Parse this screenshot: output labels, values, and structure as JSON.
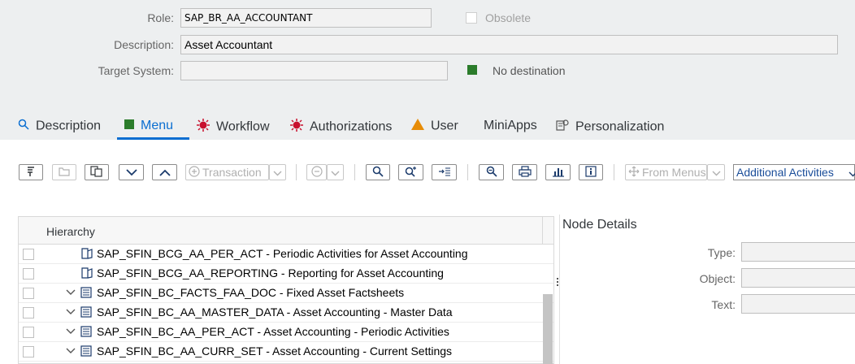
{
  "header": {
    "role_label": "Role:",
    "role_value": "SAP_BR_AA_ACCOUNTANT",
    "obsolete_label": "Obsolete",
    "description_label": "Description:",
    "description_value": "Asset Accountant",
    "target_system_label": "Target System:",
    "target_system_value": "",
    "destination_status": "No destination",
    "destination_status_color": "#2b7c2b"
  },
  "tabs": [
    {
      "label": "Description",
      "icon": "magnifier-icon",
      "active": false
    },
    {
      "label": "Menu",
      "icon": "green-square-icon",
      "active": true
    },
    {
      "label": "Workflow",
      "icon": "red-burst-icon",
      "active": false
    },
    {
      "label": "Authorizations",
      "icon": "red-burst-icon",
      "active": false
    },
    {
      "label": "User",
      "icon": "warning-triangle-icon",
      "active": false
    },
    {
      "label": "MiniApps",
      "icon": "",
      "active": false
    },
    {
      "label": "Personalization",
      "icon": "personalization-icon",
      "active": false
    }
  ],
  "toolbar": {
    "transaction_label": "Transaction",
    "from_menus_label": "From Menus",
    "additional_activities_label": "Additional Activities"
  },
  "tree": {
    "header": "Hierarchy",
    "rows": [
      {
        "text": "SAP_SFIN_BCG_AA_PER_ACT - Periodic Activities for Asset Accounting",
        "expandable": false,
        "icon": "catalog-icon"
      },
      {
        "text": "SAP_SFIN_BCG_AA_REPORTING - Reporting for Asset Accounting",
        "expandable": false,
        "icon": "catalog-icon"
      },
      {
        "text": "SAP_SFIN_BC_FACTS_FAA_DOC - Fixed Asset Factsheets",
        "expandable": true,
        "icon": "list-icon"
      },
      {
        "text": "SAP_SFIN_BC_AA_MASTER_DATA - Asset Accounting - Master Data",
        "expandable": true,
        "icon": "list-icon"
      },
      {
        "text": "SAP_SFIN_BC_AA_PER_ACT - Asset Accounting - Periodic Activities",
        "expandable": true,
        "icon": "list-icon"
      },
      {
        "text": "SAP_SFIN_BC_AA_CURR_SET - Asset Accounting - Current Settings",
        "expandable": true,
        "icon": "list-icon"
      }
    ]
  },
  "node_details": {
    "title": "Node Details",
    "type_label": "Type:",
    "object_label": "Object:",
    "text_label": "Text:"
  },
  "colors": {
    "accent": "#0a6ed1",
    "header_bg": "#edeff0"
  }
}
